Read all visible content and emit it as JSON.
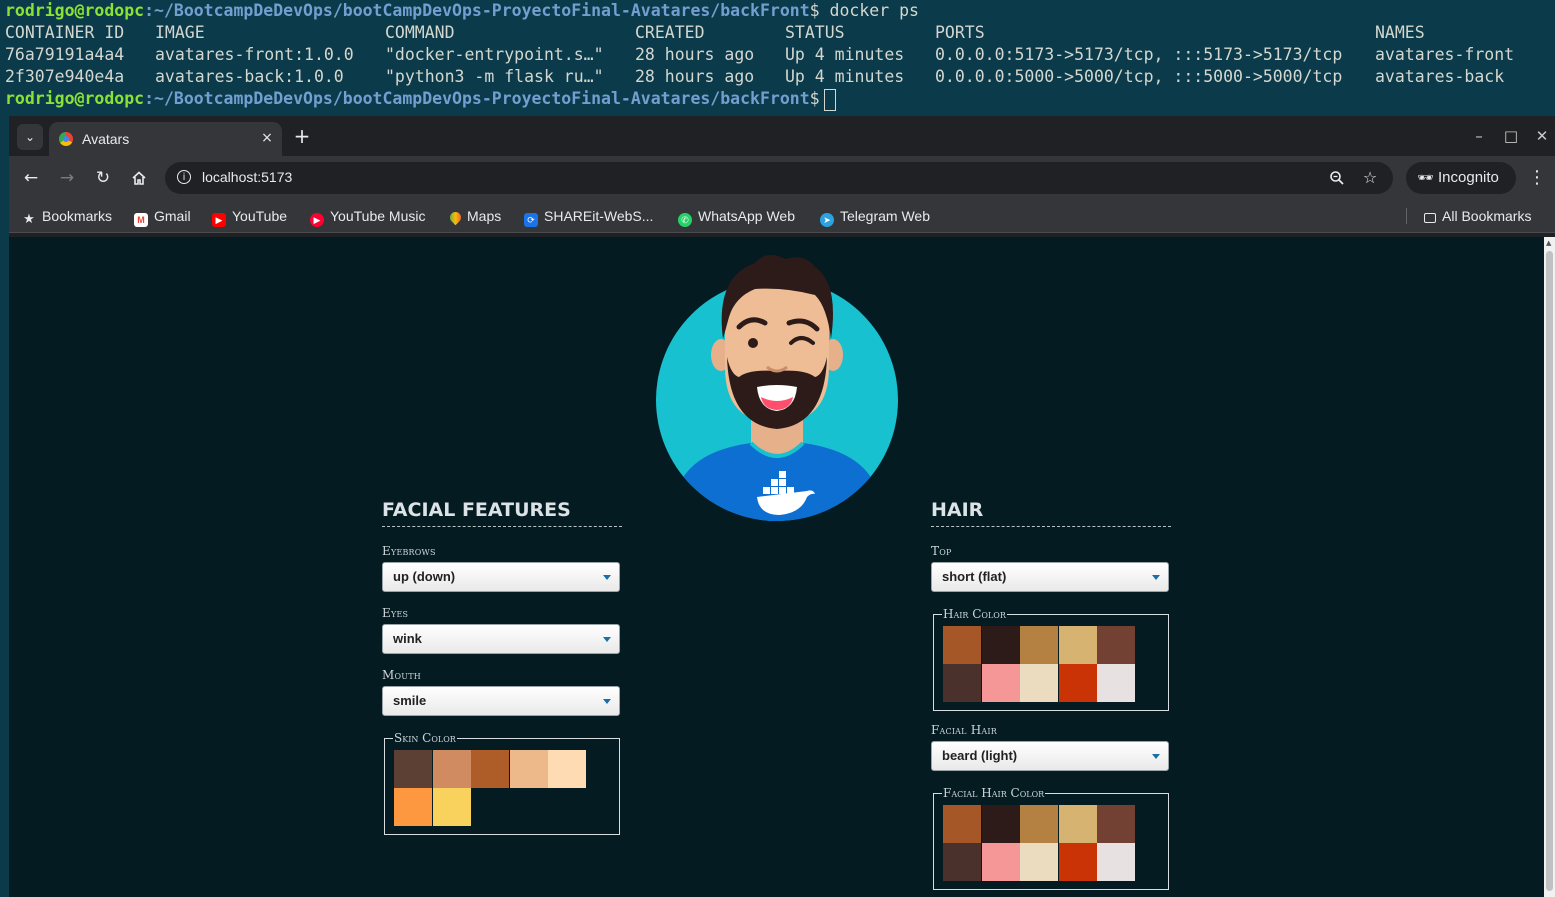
{
  "terminal": {
    "prompt_user": "rodrigo@rodopc",
    "prompt_path": ":~/BootcampDeDevOps/bootCampDevOps-ProyectoFinal-Avatares/backFront",
    "prompt_symbol": "$",
    "command": " docker ps",
    "headers": [
      "CONTAINER ID",
      "IMAGE",
      "COMMAND",
      "CREATED",
      "STATUS",
      "PORTS",
      "NAMES"
    ],
    "rows": [
      [
        "76a79191a4a4",
        "avatares-front:1.0.0",
        "\"docker-entrypoint.s…\"",
        "28 hours ago",
        "Up 4 minutes",
        "0.0.0.0:5173->5173/tcp, :::5173->5173/tcp",
        "avatares-front"
      ],
      [
        "2f307e940e4a",
        "avatares-back:1.0.0",
        "\"python3 -m flask ru…\"",
        "28 hours ago",
        "Up 4 minutes",
        "0.0.0.0:5000->5000/tcp, :::5000->5000/tcp",
        "avatares-back"
      ]
    ]
  },
  "browser": {
    "tab_title": "Avatars",
    "tab_close": "×",
    "new_tab": "+",
    "window_controls": {
      "minimize": "–",
      "maximize": "□",
      "close": "✕"
    },
    "url": "localhost:5173",
    "incognito_label": "Incognito",
    "bookmarks": [
      {
        "label": "Bookmarks",
        "icon": "star-icon",
        "color": "#e8eaed"
      },
      {
        "label": "Gmail",
        "icon": "gmail-icon",
        "color": "#ea4335"
      },
      {
        "label": "YouTube",
        "icon": "youtube-icon",
        "color": "#ff0000"
      },
      {
        "label": "YouTube Music",
        "icon": "youtube-music-icon",
        "color": "#ff0033"
      },
      {
        "label": "Maps",
        "icon": "maps-icon",
        "color": "#34a853"
      },
      {
        "label": "SHAREit-WebS...",
        "icon": "shareit-icon",
        "color": "#1a73e8"
      },
      {
        "label": "WhatsApp Web",
        "icon": "whatsapp-icon",
        "color": "#25d366"
      },
      {
        "label": "Telegram Web",
        "icon": "telegram-icon",
        "color": "#2aa3e0"
      }
    ],
    "all_bookmarks": "All Bookmarks"
  },
  "app": {
    "colors": {
      "background": "#041b22",
      "circle": "#18c1cf",
      "shirt": "#0c6fd1"
    },
    "facial_features": {
      "title": "FACIAL FEATURES",
      "eyebrows": {
        "label": "Eyebrows",
        "value": "up (down)"
      },
      "eyes": {
        "label": "Eyes",
        "value": "wink"
      },
      "mouth": {
        "label": "Mouth",
        "value": "smile"
      },
      "skin_color": {
        "label": "Skin Color",
        "swatches": [
          "#5d4034",
          "#d08c60",
          "#ae5d29",
          "#edb98a",
          "#ffdbb4",
          "#fd9841",
          "#f8d25c"
        ]
      }
    },
    "hair": {
      "title": "HAIR",
      "top": {
        "label": "Top",
        "value": "short (flat)"
      },
      "hair_color": {
        "label": "Hair Color",
        "swatches": [
          "#a55728",
          "#2c1b18",
          "#b58143",
          "#d6b370",
          "#724133",
          "#4a312c",
          "#f59797",
          "#ecdcbf",
          "#c93305",
          "#e8e1e1"
        ]
      },
      "facial_hair": {
        "label": "Facial Hair",
        "value": "beard (light)"
      },
      "facial_hair_color": {
        "label": "Facial Hair Color",
        "swatches": [
          "#a55728",
          "#2c1b18",
          "#b58143",
          "#d6b370",
          "#724133",
          "#4a312c",
          "#f59797",
          "#ecdcbf",
          "#c93305",
          "#e8e1e1"
        ]
      }
    }
  }
}
